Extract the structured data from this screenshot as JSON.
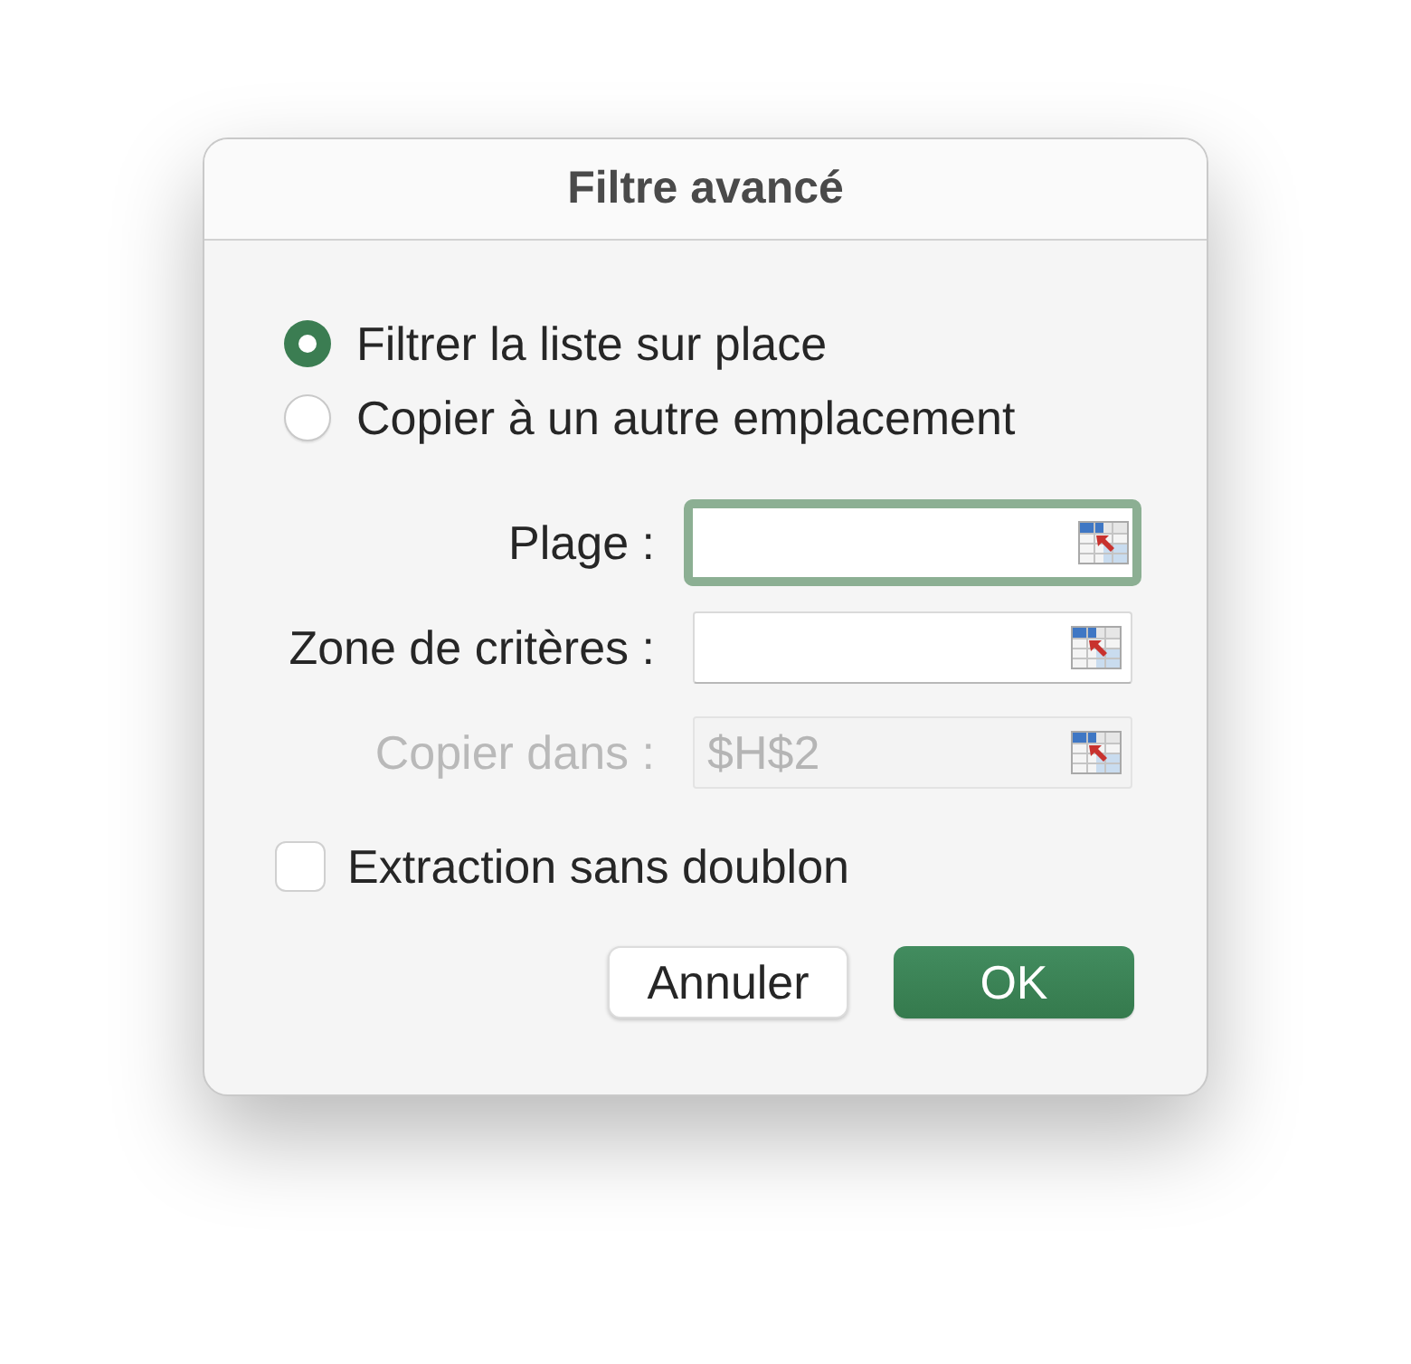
{
  "window": {
    "title": "Filtre avancé"
  },
  "options": [
    {
      "label": "Filtrer la liste sur place",
      "selected": true
    },
    {
      "label": "Copier à un autre emplacement",
      "selected": false
    }
  ],
  "fields": [
    {
      "label": "Plage :",
      "focused": true,
      "disabled": false
    },
    {
      "label": "Zone de critères :",
      "focused": false,
      "disabled": false
    },
    {
      "label": "Copier dans :",
      "value": "$H$2",
      "focused": false,
      "disabled": true
    }
  ],
  "checkbox": {
    "label": "Extraction sans doublon",
    "checked": false
  },
  "buttons": [
    {
      "label": "Annuler",
      "kind": "secondary"
    },
    {
      "label": "OK",
      "kind": "primary"
    }
  ]
}
